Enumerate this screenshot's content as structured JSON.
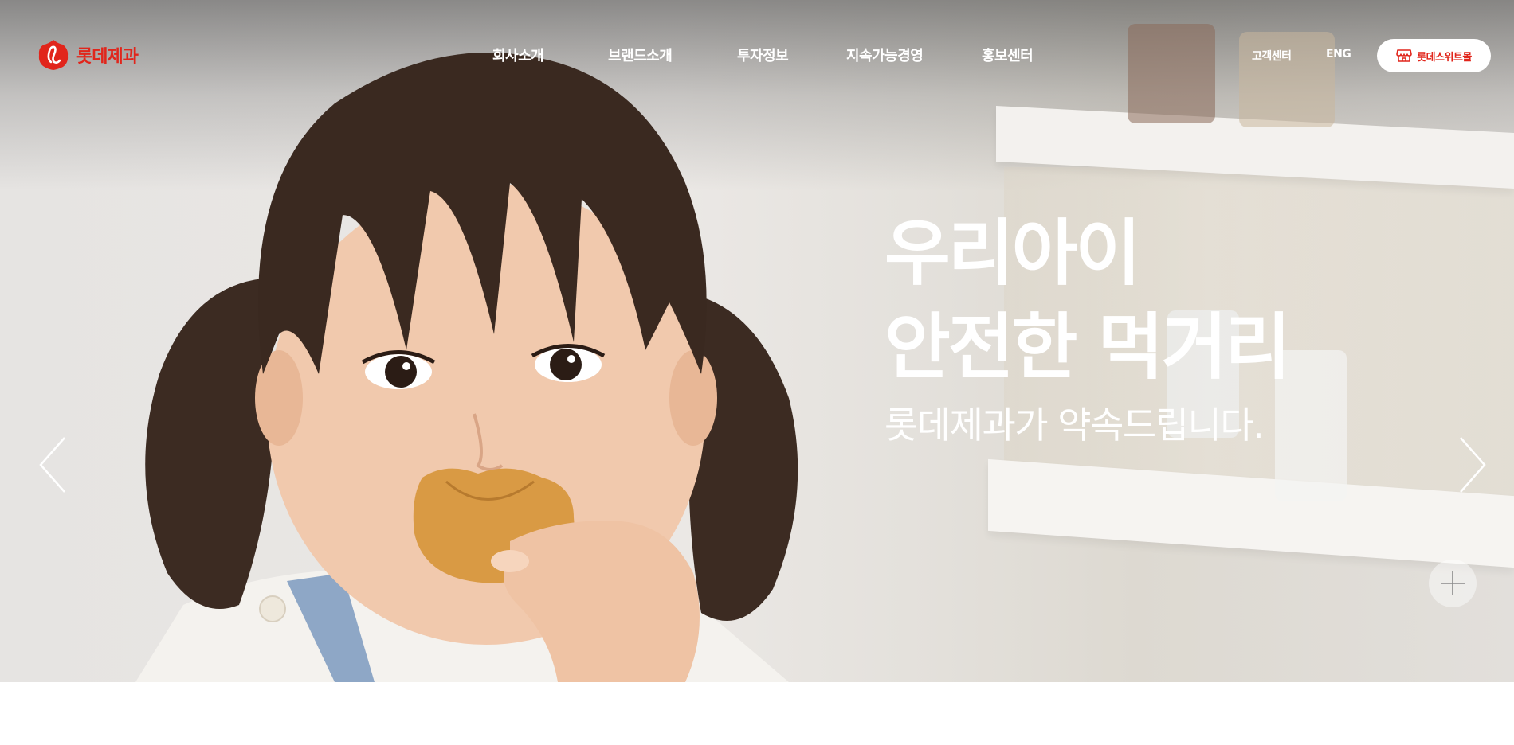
{
  "brand": {
    "name": "롯데제과",
    "color": "#e1251b"
  },
  "nav": {
    "items": [
      {
        "label": "회사소개"
      },
      {
        "label": "브랜드소개"
      },
      {
        "label": "투자정보"
      },
      {
        "label": "지속가능경영"
      },
      {
        "label": "홍보센터"
      }
    ]
  },
  "utility": {
    "customer_center": "고객센터",
    "language": "ENG",
    "mall_button": "롯데스위트몰",
    "mall_icon": "store-icon"
  },
  "hero": {
    "headline_line1": "우리아이",
    "headline_line2": "안전한 먹거리",
    "subline": "롯데제과가 약속드립니다.",
    "prev_icon": "chevron-left-icon",
    "next_icon": "chevron-right-icon",
    "more_icon": "plus-icon"
  }
}
